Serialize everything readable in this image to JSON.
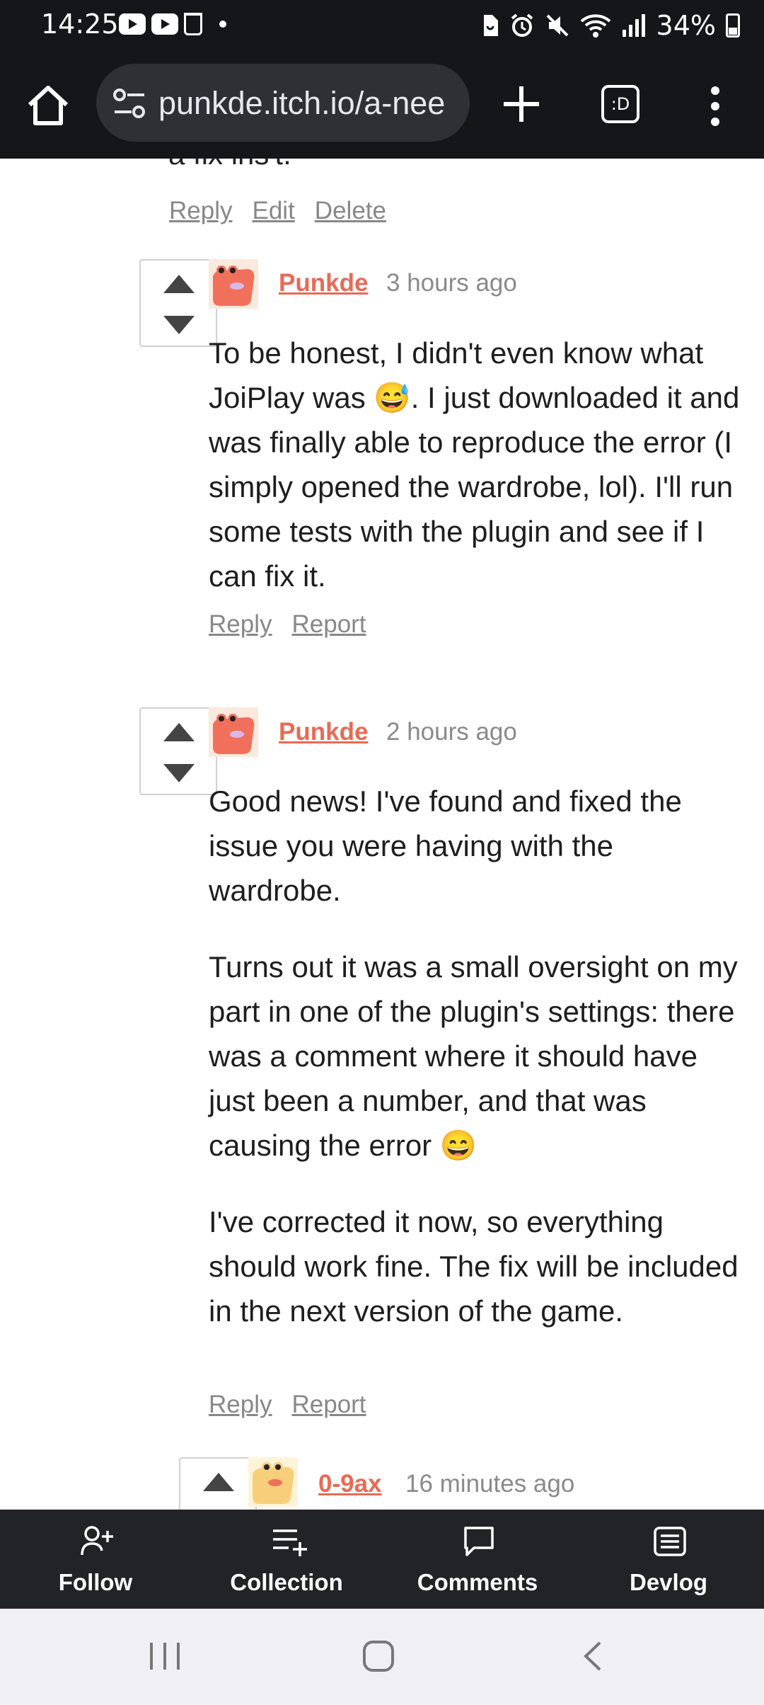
{
  "status_bar": {
    "time": "14:25",
    "battery": "34%",
    "icons": [
      "youtube-icon",
      "youtube-icon",
      "cup-icon",
      "dot-icon",
      "sim-icon",
      "alarm-icon",
      "mute-icon",
      "wifi-icon",
      "signal-icon",
      "battery-icon"
    ]
  },
  "browser": {
    "url": "punkde.itch.io/a-nee",
    "tabs_label": ":D",
    "icons": [
      "home-icon",
      "site-settings-icon",
      "plus-icon",
      "tabs-icon",
      "more-icon"
    ]
  },
  "thread": {
    "cutoff_text": "a fix ins't.",
    "top_actions": [
      "Reply",
      "Edit",
      "Delete"
    ],
    "comments": [
      {
        "author": "Punkde",
        "time": "3 hours ago",
        "paragraphs": [
          "To be honest, I didn't even know what JoiPlay was 😅. I just downloaded it and was finally able to reproduce the error (I simply opened the wardrobe, lol). I'll run some tests with the plugin and see if I can fix it."
        ],
        "actions": [
          "Reply",
          "Report"
        ]
      },
      {
        "author": "Punkde",
        "time": "2 hours ago",
        "paragraphs": [
          "Good news! I've found and fixed the issue you were having with the wardrobe.",
          "Turns out it was a small oversight on my part in one of the plugin's settings: there was a comment where it should have just been a number, and that was causing the error 😄",
          "I've corrected it now, so everything should work fine. The fix will be included in the next version of the game."
        ],
        "actions": [
          "Reply",
          "Report"
        ]
      },
      {
        "author": "0-9ax",
        "time": "16 minutes ago"
      }
    ]
  },
  "bottom_nav": [
    {
      "label": "Follow",
      "icon": "follow-icon"
    },
    {
      "label": "Collection",
      "icon": "collection-icon"
    },
    {
      "label": "Comments",
      "icon": "comments-icon"
    },
    {
      "label": "Devlog",
      "icon": "devlog-icon"
    }
  ],
  "colors": {
    "author": "#e86a56",
    "bar_bg": "#15161a",
    "nav_bg": "#222326"
  }
}
